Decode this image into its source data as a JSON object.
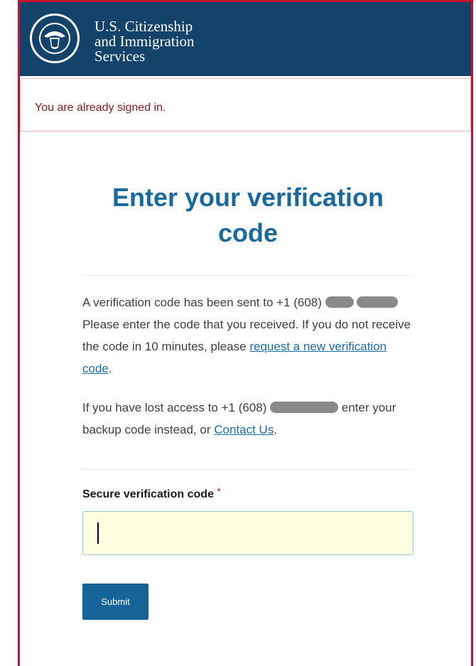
{
  "header": {
    "agency_line1": "U.S. Citizenship",
    "agency_line2": "and Immigration",
    "agency_line3": "Services",
    "seal_icon": "dhs-seal-icon",
    "background_color": "#13426b"
  },
  "alert": {
    "message": "You are already signed in."
  },
  "main": {
    "title": "Enter your verification code",
    "sent_text_before": "A verification code has been sent to +1 (608)",
    "sent_text_after": "Please enter the code that you received. If you do not receive the code in 10 minutes, please",
    "request_link": "request a new verification code",
    "lost_access_before": "If you have lost access to +1 (608)",
    "lost_access_after": "enter your backup code instead, or",
    "contact_link": "Contact Us",
    "field_label": "Secure verification code",
    "required_marker": "*",
    "code_value": "",
    "submit_label": "Submit"
  },
  "colors": {
    "accent": "#17699f",
    "button": "#16639a",
    "alert_text": "#8a1d22",
    "input_bg": "#fdfde0"
  }
}
